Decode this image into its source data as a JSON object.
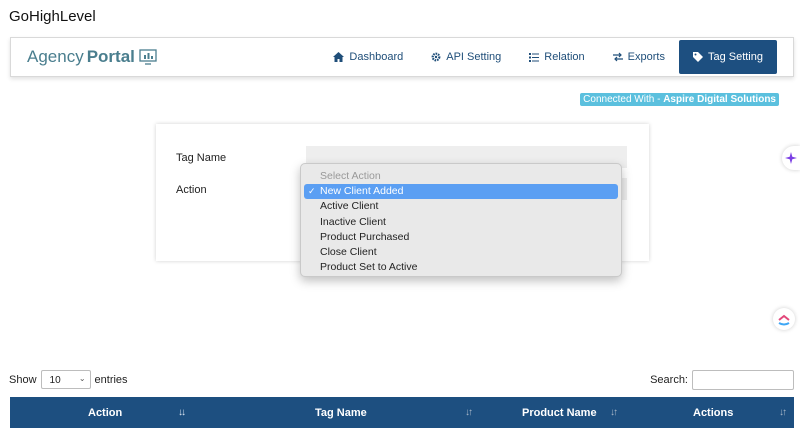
{
  "app_title": "GoHighLevel",
  "brand": {
    "part1": "Agency",
    "part2": "Portal"
  },
  "nav": [
    {
      "label": "Dashboard",
      "icon": "home-icon"
    },
    {
      "label": "API Setting",
      "icon": "gear-icon"
    },
    {
      "label": "Relation",
      "icon": "list-icon"
    },
    {
      "label": "Exports",
      "icon": "exchange-icon"
    },
    {
      "label": "Tag Setting",
      "icon": "tag-icon",
      "active": true
    }
  ],
  "connected": {
    "prefix": "Connected With - ",
    "name": "Aspire Digital Solutions"
  },
  "form": {
    "tag_name_label": "Tag Name",
    "action_label": "Action"
  },
  "dropdown": {
    "placeholder": "Select Action",
    "options": [
      "New Client Added",
      "Active Client",
      "Inactive Client",
      "Product Purchased",
      "Close Client",
      "Product Set to Active"
    ],
    "selected": "New Client Added"
  },
  "table_controls": {
    "show_label": "Show",
    "page_size": "10",
    "entries_label": "entries",
    "search_label": "Search:"
  },
  "table": {
    "headers": [
      "Action",
      "Tag Name",
      "Product Name",
      "Actions"
    ]
  },
  "colors": {
    "primary": "#1d4f80",
    "badge": "#5bc0de",
    "selected": "#5b9ff3"
  }
}
